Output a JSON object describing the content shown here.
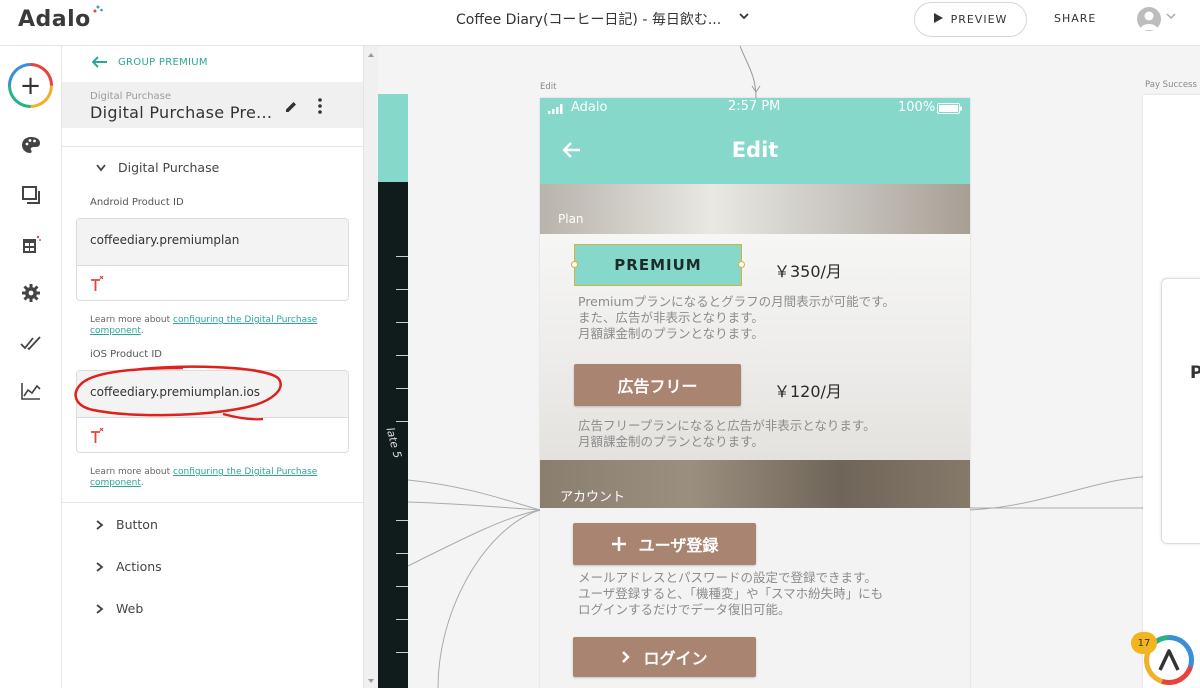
{
  "app": {
    "logo_text": "Adalo"
  },
  "topbar": {
    "project_title": "Coffee Diary(コーヒー日記) - 毎日飲む...",
    "preview_label": "PREVIEW",
    "share_label": "SHARE"
  },
  "panel": {
    "back_label": "GROUP PREMIUM",
    "component_type": "Digital Purchase",
    "component_title": "Digital Purchase Pre...",
    "section_label": "Digital Purchase",
    "android": {
      "label": "Android Product ID",
      "value": "coffeediary.premiumplan",
      "learn_prefix": "Learn more about ",
      "learn_link": "configuring the Digital Purchase component",
      "learn_suffix": "."
    },
    "ios": {
      "label": "iOS Product ID",
      "value": "coffeediary.premiumplan.ios",
      "learn_prefix": "Learn more about ",
      "learn_link": "configuring the Digital Purchase component",
      "learn_suffix": "."
    },
    "collapsed_sections": [
      "Button",
      "Actions",
      "Web"
    ]
  },
  "canvas": {
    "left_screen_text": "late 5",
    "edit_screen_label": "Edit",
    "pay_screen_label": "Pay Success",
    "right_letter": "P",
    "phone": {
      "carrier": "Adalo",
      "time": "2:57 PM",
      "battery": "100%",
      "title": "Edit",
      "plan_label": "Plan",
      "premium_button": "PREMIUM",
      "premium_price": "￥350/月",
      "premium_desc": [
        "Premiumプランになるとグラフの月間表示が可能です。",
        "また、広告が非表示となります。",
        "月額課金制のプランとなります。"
      ],
      "adfree_button": "広告フリー",
      "adfree_price": "￥120/月",
      "adfree_desc": [
        "広告フリープランになると広告が非表示となります。",
        "月額課金制のプランとなります。"
      ],
      "account_label": "アカウント",
      "register_button": "ユーザ登録",
      "register_desc": [
        "メールアドレスとパスワードの設定で登録できます。",
        "ユーザ登録すると、「機種変」や「スマホ紛失時」にも",
        "ログインするだけでデータ復旧可能。"
      ],
      "login_button": "ログイン"
    }
  },
  "help": {
    "notification_count": "17"
  },
  "colors": {
    "accent": "#2aa797",
    "teal": "#86d8ca",
    "brown": "#a98571",
    "annotation": "#e0201b"
  }
}
